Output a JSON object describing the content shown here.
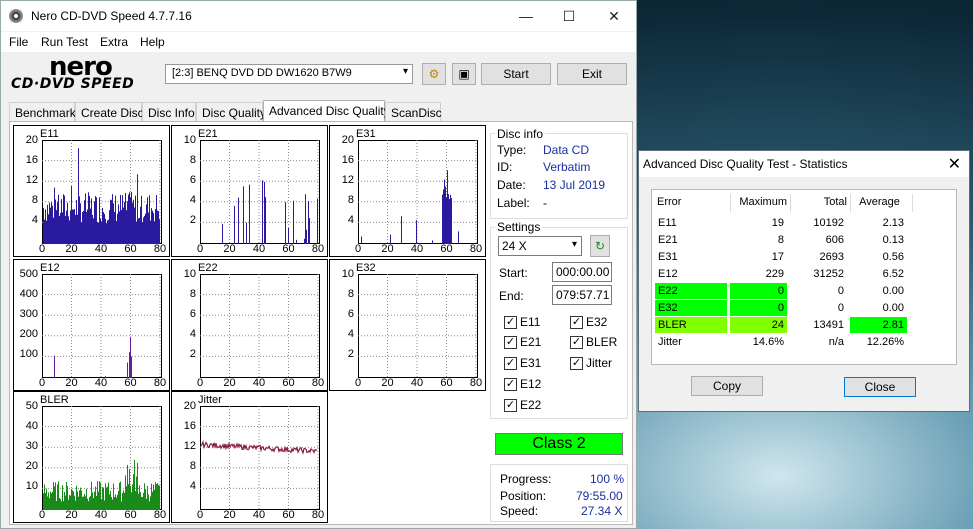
{
  "window": {
    "title": "Nero CD-DVD Speed 4.7.7.16",
    "minimize": "—",
    "maximize": "☐",
    "close": "✕"
  },
  "menu": [
    "File",
    "Run Test",
    "Extra",
    "Help"
  ],
  "logo": {
    "top": "nero",
    "bottom": "CD·DVD SPEED"
  },
  "drive": {
    "selected": "[2:3]   BENQ DVD DD DW1620 B7W9"
  },
  "toolbar": {
    "start_label": "Start",
    "exit_label": "Exit"
  },
  "tabs": [
    "Benchmark",
    "Create Disc",
    "Disc Info",
    "Disc Quality",
    "Advanced Disc Quality",
    "ScanDisc"
  ],
  "active_tab": "Advanced Disc Quality",
  "disc_info": {
    "title": "Disc info",
    "type_label": "Type:",
    "type": "Data CD",
    "id_label": "ID:",
    "id": "Verbatim",
    "date_label": "Date:",
    "date": "13 Jul 2019",
    "label_label": "Label:",
    "label": "-"
  },
  "settings": {
    "title": "Settings",
    "speed": "24 X",
    "start_label": "Start:",
    "start": "000:00.00",
    "end_label": "End:",
    "end": "079:57.71",
    "checks": [
      {
        "label": "E11",
        "checked": true
      },
      {
        "label": "E32",
        "checked": true
      },
      {
        "label": "E21",
        "checked": true
      },
      {
        "label": "BLER",
        "checked": true
      },
      {
        "label": "E31",
        "checked": true
      },
      {
        "label": "Jitter",
        "checked": true
      },
      {
        "label": "E12",
        "checked": true
      },
      {
        "label": "E22",
        "checked": true
      }
    ]
  },
  "class_label": "Class 2",
  "progress": {
    "progress_label": "Progress:",
    "progress": "100 %",
    "position_label": "Position:",
    "position": "79:55.00",
    "speed_label": "Speed:",
    "speed": "27.34 X"
  },
  "charts": [
    {
      "name": "E11",
      "yticks": [
        "20",
        "16",
        "12",
        "8",
        "4"
      ],
      "xticks": [
        "0",
        "20",
        "40",
        "60",
        "80"
      ],
      "color": "#2a1aa0"
    },
    {
      "name": "E21",
      "yticks": [
        "10",
        "8",
        "6",
        "4",
        "2"
      ],
      "xticks": [
        "0",
        "20",
        "40",
        "60",
        "80"
      ],
      "color": "#2a1aa0"
    },
    {
      "name": "E31",
      "yticks": [
        "20",
        "16",
        "12",
        "8",
        "4"
      ],
      "xticks": [
        "0",
        "20",
        "40",
        "60",
        "80"
      ],
      "color": "#2a1aa0"
    },
    {
      "name": "E12",
      "yticks": [
        "500",
        "400",
        "300",
        "200",
        "100"
      ],
      "xticks": [
        "0",
        "20",
        "40",
        "60",
        "80"
      ],
      "color": "#6a1a9a"
    },
    {
      "name": "E22",
      "yticks": [
        "10",
        "8",
        "6",
        "4",
        "2"
      ],
      "xticks": [
        "0",
        "20",
        "40",
        "60",
        "80"
      ],
      "color": "#2a1aa0"
    },
    {
      "name": "E32",
      "yticks": [
        "10",
        "8",
        "6",
        "4",
        "2"
      ],
      "xticks": [
        "0",
        "20",
        "40",
        "60",
        "80"
      ],
      "color": "#2a1aa0"
    },
    {
      "name": "BLER",
      "yticks": [
        "50",
        "40",
        "30",
        "20",
        "10"
      ],
      "xticks": [
        "0",
        "20",
        "40",
        "60",
        "80"
      ],
      "color": "#1a8a1a"
    },
    {
      "name": "Jitter",
      "yticks": [
        "20",
        "16",
        "12",
        "8",
        "4"
      ],
      "xticks": [
        "0",
        "20",
        "40",
        "60",
        "80"
      ],
      "color": "#8a1a3a"
    }
  ],
  "stats": {
    "title": "Advanced Disc Quality Test - Statistics",
    "headers": [
      "Error",
      "Maximum",
      "Total",
      "Average"
    ],
    "rows": [
      [
        "E11",
        "19",
        "10192",
        "2.13"
      ],
      [
        "E21",
        "8",
        "606",
        "0.13"
      ],
      [
        "E31",
        "17",
        "2693",
        "0.56"
      ],
      [
        "E12",
        "229",
        "31252",
        "6.52"
      ],
      [
        "E22",
        "0",
        "0",
        "0.00"
      ],
      [
        "E32",
        "0",
        "0",
        "0.00"
      ],
      [
        "BLER",
        "24",
        "13491",
        "2.81"
      ],
      [
        "Jitter",
        "14.6%",
        "n/a",
        "12.26%"
      ]
    ],
    "copy_label": "Copy",
    "close_label": "Close"
  }
}
